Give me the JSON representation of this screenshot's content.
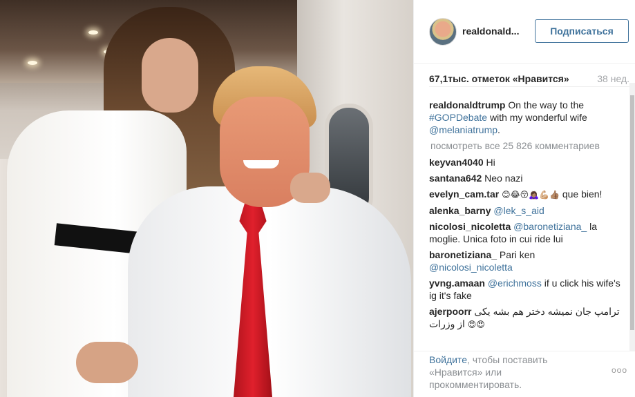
{
  "post": {
    "username": "realdonald...",
    "follow_label": "Подписаться",
    "likes": "67,1тыс. отметок «Нравится»",
    "time": "38 нед.",
    "caption": {
      "user": "realdonaldtrump",
      "text_1": "On the way to the",
      "hashtag": "#GOPDebate",
      "text_2": "with my wonderful wife",
      "mention": "@melaniatrump",
      "text_3": "."
    },
    "view_all": "посмотреть все 25 826 комментариев",
    "comments": [
      {
        "user": "keyvan4040",
        "text": "Hi"
      },
      {
        "user": "santana642",
        "text": "Neo nazi"
      },
      {
        "user": "evelyn_cam.tar",
        "emoji": "😊😂😚🙇🏽‍♀️💪🏼👍🏽",
        "text": "que bien!"
      },
      {
        "user": "alenka_barny",
        "mention": "@lek_s_aid"
      },
      {
        "user": "nicolosi_nicoletta",
        "mention": "@baronetiziana_",
        "text": "la moglie. Unica foto in cui ride lui"
      },
      {
        "user": "baronetiziana_",
        "text": "Pari ken",
        "mention": "@nicolosi_nicoletta"
      },
      {
        "user": "yvng.amaan",
        "mention": "@erichmoss",
        "text": "if u click his wife's ig it's fake"
      },
      {
        "user": "ajerpoorr",
        "text": "ترامپ جان نمیشه دختر هم بشه یکی از وزرات",
        "emoji": "😍😍"
      }
    ],
    "footer": {
      "login_link": "Войдите",
      "login_text": ", чтобы поставить «Нравится» или прокомментировать.",
      "more": "ooo"
    }
  },
  "icons": {
    "avatar": "avatar-photo",
    "more": "more-options-icon"
  },
  "colors": {
    "link": "#3f729b",
    "muted": "#a5a7aa",
    "text": "#262626",
    "tie_red": "#e0202c"
  }
}
